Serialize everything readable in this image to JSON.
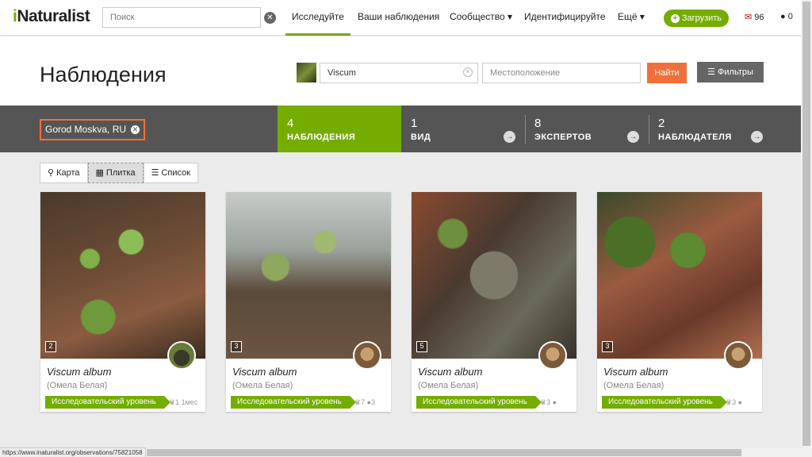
{
  "nav": {
    "logo_i": "i",
    "logo_rest": "Naturalist",
    "search_placeholder": "Поиск",
    "items": [
      "Исследуйте",
      "Ваши наблюдения",
      "Сообщество ▾",
      "Идентифицируйте",
      "Ещё ▾"
    ],
    "upload_label": "Загрузить",
    "messages_count": "96",
    "comments_count": "0"
  },
  "header": {
    "title": "Наблюдения",
    "taxon_value": "Viscum",
    "place_placeholder": "Местоположение",
    "go_label": "Найти",
    "filters_label": "Фильтры"
  },
  "stats": {
    "place_chip": "Gorod Moskva, RU",
    "items": [
      {
        "num": "4",
        "label": "НАБЛЮДЕНИЯ"
      },
      {
        "num": "1",
        "label": "ВИД"
      },
      {
        "num": "8",
        "label": "ЭКСПЕРТОВ"
      },
      {
        "num": "2",
        "label": "НАБЛЮДАТЕЛЯ"
      }
    ]
  },
  "views": {
    "map": "Карта",
    "grid": "Плитка",
    "list": "Список"
  },
  "cards": [
    {
      "count": "2",
      "sci": "Viscum album",
      "common": "(Омела Белая)",
      "grade": "Исследовательский уровень",
      "meta": "♛1 1мес"
    },
    {
      "count": "3",
      "sci": "Viscum album",
      "common": "(Омела Белая)",
      "grade": "Исследовательский уровень",
      "meta": "♛7 ●3"
    },
    {
      "count": "5",
      "sci": "Viscum album",
      "common": "(Омела Белая)",
      "grade": "Исследовательский уровень",
      "meta": "♛3 ●"
    },
    {
      "count": "3",
      "sci": "Viscum album",
      "common": "(Омела Белая)",
      "grade": "Исследовательский уровень",
      "meta": "♛3 ●"
    }
  ],
  "status_url": "https://www.inaturalist.org/observations/75821058",
  "colors": {
    "accent": "#74ac00",
    "orange": "#f16f3a",
    "bar": "#555555"
  }
}
